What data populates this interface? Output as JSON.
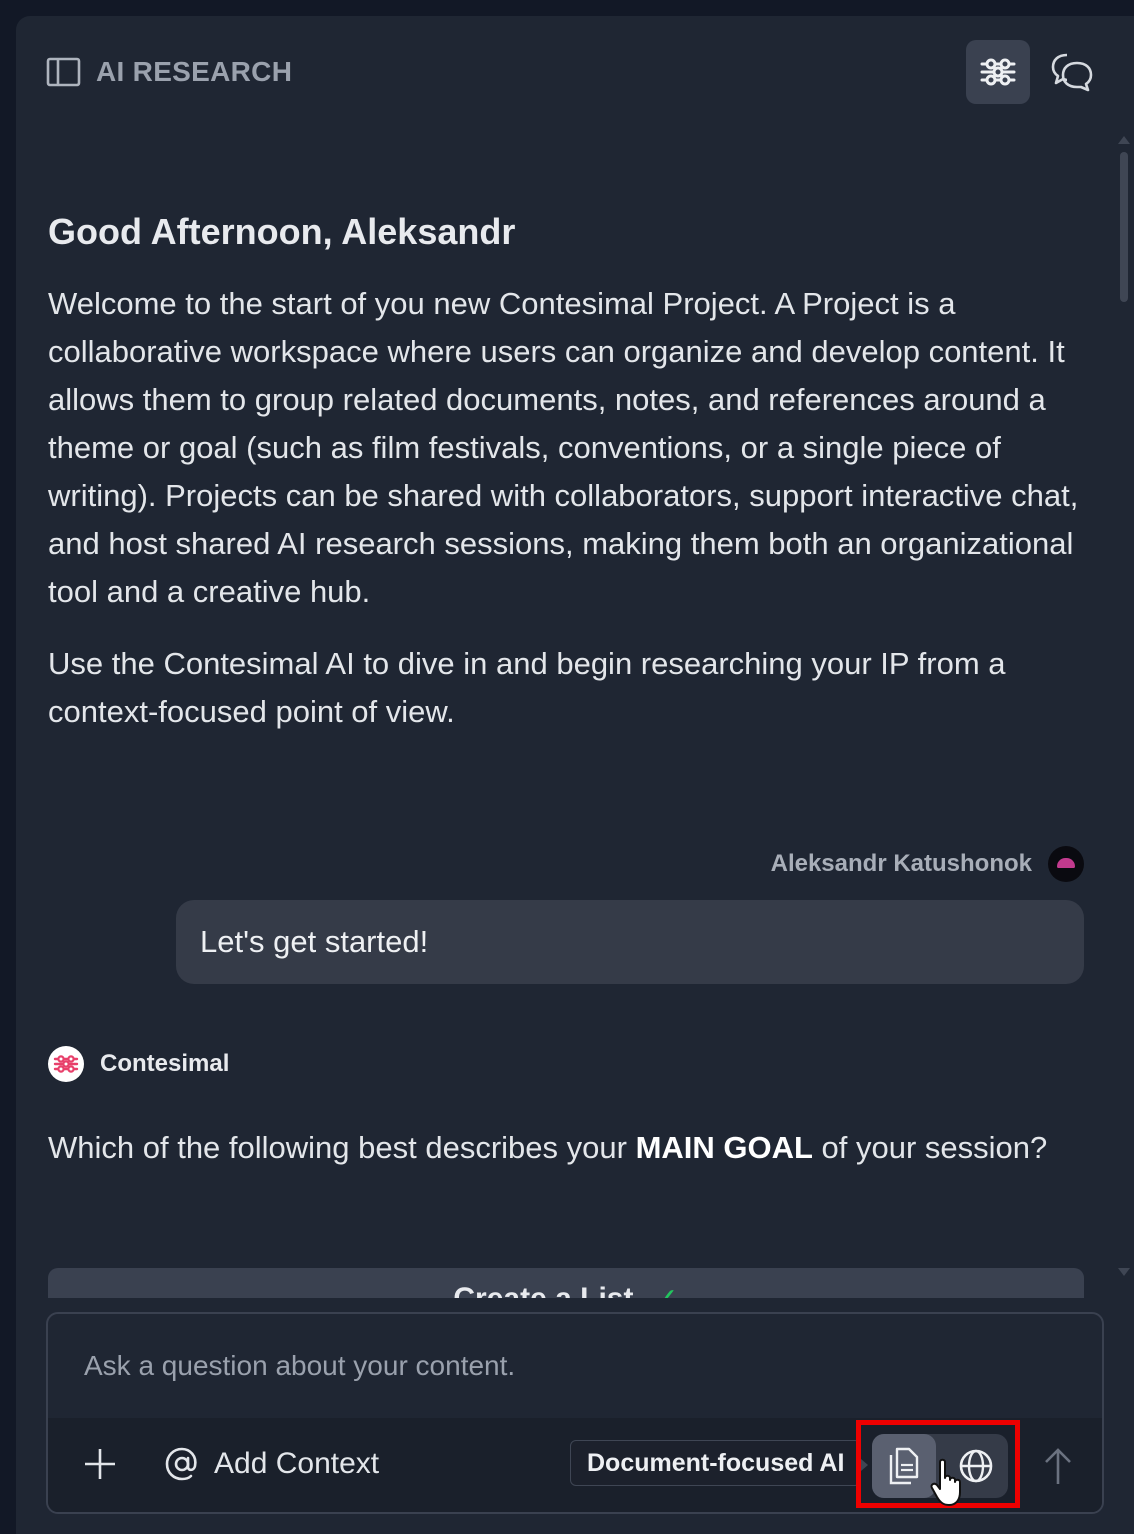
{
  "header": {
    "title": "AI RESEARCH"
  },
  "conversation": {
    "greeting": "Good Afternoon, Aleksandr",
    "intro": "Welcome to the start of you new Contesimal Project. A Project is a collaborative workspace where users can organize and develop content. It allows them to group related documents, notes, and references around a theme or goal (such as film festivals, conventions, or a single piece of writing). Projects can be shared with collaborators, support interactive chat, and host shared AI research sessions, making them both an organizational tool and a creative hub.",
    "intro2": "Use the Contesimal AI to dive in and begin researching your IP from a context-focused point of view.",
    "user": {
      "name": "Aleksandr Katushonok",
      "message": "Let's get started!"
    },
    "bot": {
      "name": "Contesimal",
      "question_before": "Which of the following best describes your ",
      "question_bold": "MAIN GOAL",
      "question_after": " of your session?"
    },
    "option": {
      "label": "Create a List",
      "check": "✓"
    }
  },
  "composer": {
    "placeholder": "Ask a question about your content.",
    "add_context_label": "Add Context",
    "tooltip": "Document-focused AI"
  },
  "icons": {
    "sidebar_toggle": "sidebar-toggle-icon",
    "research": "research-icon",
    "chat": "chat-icon",
    "plus": "plus-icon",
    "at": "at-icon",
    "document": "document-icon",
    "globe": "globe-icon",
    "send": "arrow-up-icon"
  },
  "colors": {
    "background": "#121826",
    "panel": "#1f2633",
    "bubble": "#353b48",
    "brand": "#e8406b",
    "highlight": "#ee0000",
    "check": "#22c55e"
  }
}
